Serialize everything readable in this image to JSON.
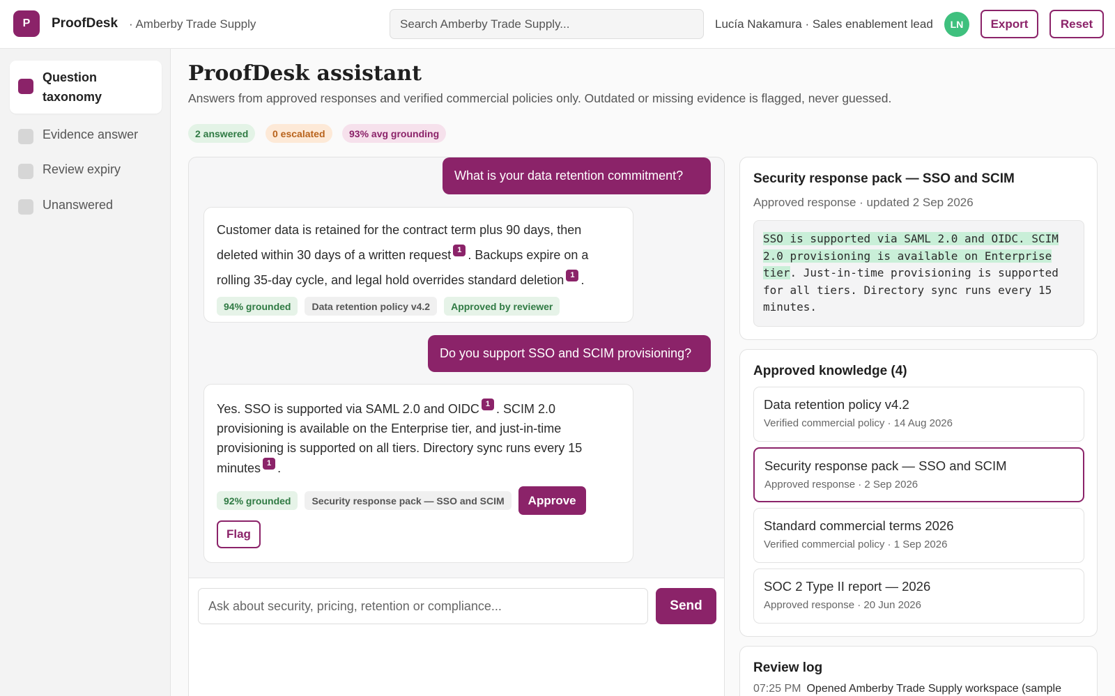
{
  "header": {
    "logo_letter": "P",
    "app_name": "ProofDesk",
    "org_name": "· Amberby Trade Supply",
    "search_placeholder": "Search Amberby Trade Supply...",
    "user_label": "Lucía Nakamura · Sales enablement lead",
    "avatar_initials": "LN",
    "export_label": "Export",
    "reset_label": "Reset"
  },
  "sidebar": {
    "items": [
      {
        "label": "Question taxonomy",
        "active": true
      },
      {
        "label": "Evidence answer",
        "active": false
      },
      {
        "label": "Review expiry",
        "active": false
      },
      {
        "label": "Unanswered",
        "active": false
      }
    ]
  },
  "main": {
    "title": "ProofDesk assistant",
    "subtitle": "Answers from approved responses and verified commercial policies only. Outdated or missing evidence is flagged, never guessed.",
    "stats": {
      "answered": "2 answered",
      "escalated": "0 escalated",
      "grounding": "93% avg grounding"
    }
  },
  "chat": {
    "q1": "What is your data retention commitment?",
    "a1": {
      "part1": "Customer data is retained for the contract term plus 90 days, then deleted within 30 days of a written request",
      "cite1": "1",
      "part2": ". Backups expire on a rolling 35-day cycle, and legal hold overrides standard deletion",
      "cite2": "1",
      "part3": ".",
      "grounded": "94% grounded",
      "source": "Data retention policy v4.2",
      "status": "Approved by reviewer"
    },
    "q2": "Do you support SSO and SCIM provisioning?",
    "a2": {
      "part1": "Yes. SSO is supported via SAML 2.0 and OIDC",
      "cite1": "1",
      "part2": ". SCIM 2.0 provisioning is available on the Enterprise tier, and just-in-time provisioning is supported on all tiers. Directory sync runs every 15 minutes",
      "cite2": "1",
      "part3": ".",
      "grounded": "92% grounded",
      "source": "Security response pack — SSO and SCIM",
      "approve_label": "Approve",
      "flag_label": "Flag"
    },
    "composer_placeholder": "Ask about security, pricing, retention or compliance...",
    "send_label": "Send"
  },
  "detail": {
    "title": "Security response pack — SSO and SCIM",
    "meta": "Approved response · updated 2 Sep 2026",
    "excerpt_highlight": "SSO is supported via SAML 2.0 and OIDC. SCIM 2.0 provisioning is available on Enterprise tier",
    "excerpt_rest": ". Just-in-time provisioning is supported for all tiers. Directory sync runs every 15 minutes."
  },
  "knowledge": {
    "title": "Approved knowledge (4)",
    "items": [
      {
        "title": "Data retention policy v4.2",
        "meta": "Verified commercial policy · 14 Aug 2026"
      },
      {
        "title": "Security response pack — SSO and SCIM",
        "meta": "Approved response · 2 Sep 2026"
      },
      {
        "title": "Standard commercial terms 2026",
        "meta": "Verified commercial policy · 1 Sep 2026"
      },
      {
        "title": "SOC 2 Type II report — 2026",
        "meta": "Approved response · 20 Jun 2026"
      }
    ]
  },
  "review_log": {
    "title": "Review log",
    "entries": [
      {
        "time": "07:25 PM",
        "text": "Opened Amberby Trade Supply workspace (sample"
      }
    ]
  },
  "colors": {
    "brand": "#8b2369",
    "avatar": "#3fc07e",
    "grounded_bg": "#e6f3e8",
    "escalated_bg": "#fde9d7",
    "highlight": "#c9efd8"
  },
  "icons": {
    "nav_item_marker": "square-icon"
  }
}
